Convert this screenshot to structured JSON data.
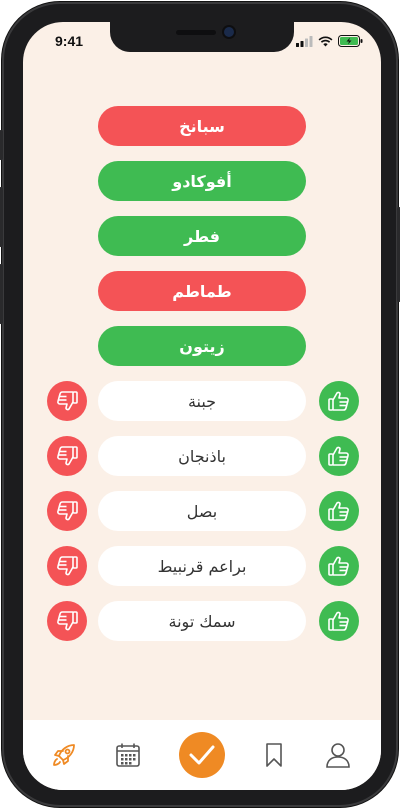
{
  "status_bar": {
    "time": "9:41"
  },
  "verdict_items": [
    {
      "label": "سبانخ",
      "verdict": "dislike",
      "color": "#f45356"
    },
    {
      "label": "أفوكادو",
      "verdict": "like",
      "color": "#3fbb52"
    },
    {
      "label": "فطر",
      "verdict": "like",
      "color": "#3fbb52"
    },
    {
      "label": "طماطم",
      "verdict": "dislike",
      "color": "#f45356"
    },
    {
      "label": "زيتون",
      "verdict": "like",
      "color": "#3fbb52"
    }
  ],
  "pending_items": [
    {
      "label": "جبنة"
    },
    {
      "label": "باذنجان"
    },
    {
      "label": "بصل"
    },
    {
      "label": "براعم قرنبيط"
    },
    {
      "label": "سمك تونة"
    }
  ],
  "icons": {
    "like": "thumbs-up-icon",
    "dislike": "thumbs-down-icon"
  },
  "tab_bar": {
    "tabs": [
      "rocket-icon",
      "calendar-icon",
      "checkmark-icon",
      "bookmark-icon",
      "user-icon"
    ],
    "active": "checkmark-icon",
    "accent": "#ef8a24"
  },
  "colors": {
    "background": "#fbf0e7",
    "like": "#3fbb52",
    "dislike": "#f45356"
  }
}
